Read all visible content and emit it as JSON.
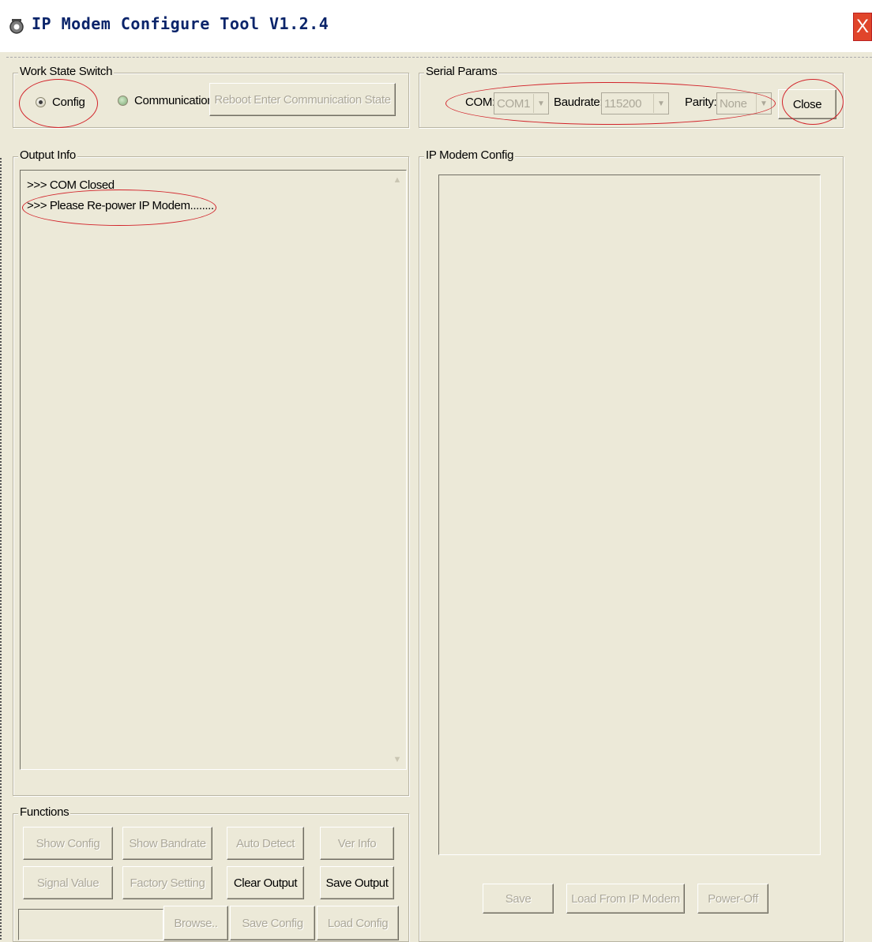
{
  "window": {
    "title": "IP Modem Configure Tool V1.2.4",
    "close_glyph": "X",
    "icon": "app-gear-icon"
  },
  "work_state": {
    "legend": "Work State Switch",
    "config_label": "Config",
    "communication_label": "Communication",
    "reboot_button": "Reboot Enter Communication State",
    "selected": "Config"
  },
  "serial_params": {
    "legend": "Serial Params",
    "com_label": "COM:",
    "com_value": "COM1",
    "baudrate_label": "Baudrate:",
    "baudrate_value": "115200",
    "parity_label": "Parity:",
    "parity_value": "None",
    "close_button": "Close"
  },
  "output_info": {
    "legend": "Output Info",
    "lines": [
      ">>> COM Closed",
      ">>> Please Re-power IP Modem........"
    ]
  },
  "ip_modem_config": {
    "legend": "IP Modem Config",
    "save_button": "Save",
    "load_button": "Load From IP Modem",
    "power_off_button": "Power-Off"
  },
  "functions": {
    "legend": "Functions",
    "show_config": "Show Config",
    "show_bandrate": "Show Bandrate",
    "auto_detect": "Auto Detect",
    "ver_info": "Ver Info",
    "signal_value": "Signal Value",
    "factory_setting": "Factory Setting",
    "clear_output": "Clear Output",
    "save_output": "Save Output",
    "path_value": "",
    "browse": "Browse..",
    "save_config": "Save Config",
    "load_config": "Load Config"
  },
  "colors": {
    "window_bg": "#ece9d8",
    "title_text": "#0a246a",
    "close_button": "#e0452b",
    "annotation_red": "#d2232a",
    "disabled_text": "#aca899"
  }
}
